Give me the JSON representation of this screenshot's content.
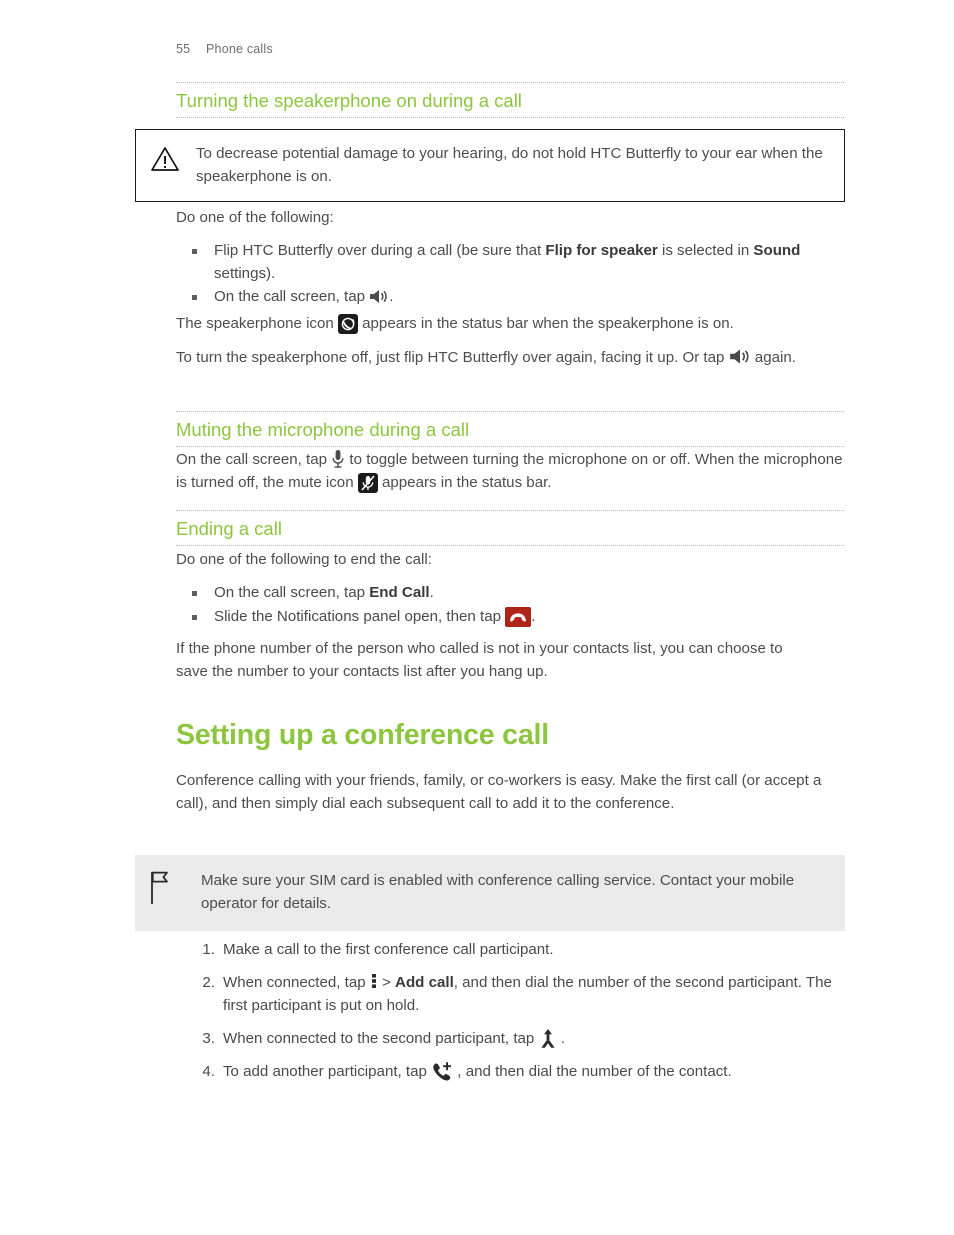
{
  "header": {
    "page_number": "55",
    "chapter": "Phone calls"
  },
  "colors": {
    "accent_green": "#8CC63F",
    "body_text": "#4d4d4d",
    "note_bg": "#eaeaea",
    "end_call_red": "#b02418",
    "status_icon_bg": "#1b1b1b"
  },
  "sections": {
    "speakerphone": {
      "heading": "Turning the speakerphone on during a call",
      "warning": "To decrease potential damage to your hearing, do not hold HTC Butterfly to your ear when the speakerphone is on.",
      "warning_icon": "warning-triangle-icon",
      "intro": "Do one of the following:",
      "bullets": [
        {
          "part1": "Flip HTC Butterfly over during a call (be sure that ",
          "bold1": "Flip for speaker",
          "part2": " is selected in ",
          "bold2": "Sound",
          "part3": " settings)."
        },
        {
          "part1": "On the call screen, tap ",
          "icon": "speaker-icon",
          "part3": "."
        }
      ],
      "para_status": {
        "part1": "The speakerphone icon ",
        "icon": "speakerphone-status-icon",
        "part2": " appears in the status bar when the speakerphone is on."
      },
      "para_off": {
        "part1": "To turn the speakerphone off, just flip HTC Butterfly over again, facing it up. Or tap ",
        "icon": "speaker-icon",
        "part2": " again."
      }
    },
    "muting": {
      "heading": "Muting the microphone during a call",
      "para": {
        "part1": "On the call screen, tap ",
        "icon1": "microphone-icon",
        "part2": " to toggle between turning the microphone on or off. When the microphone is turned off, the mute icon ",
        "icon2": "mute-status-icon",
        "part3": " appears in the status bar."
      }
    },
    "ending": {
      "heading": "Ending a call",
      "intro": "Do one of the following to end the call:",
      "bullets": [
        {
          "part1": "On the call screen, tap ",
          "bold1": "End Call",
          "part3": "."
        },
        {
          "part1": "Slide the Notifications panel open, then tap ",
          "icon": "end-call-icon",
          "part3": "."
        }
      ],
      "para_after": "If the phone number of the person who called is not in your contacts list, you can choose to save the number to your contacts list after you hang up."
    },
    "conference": {
      "heading": "Setting up a conference call",
      "intro": "Conference calling with your friends, family, or co-workers is easy. Make the first call (or accept a call), and then simply dial each subsequent call to add it to the conference.",
      "note": "Make sure your SIM card is enabled with conference calling service. Contact your mobile operator for details.",
      "note_icon": "flag-icon",
      "steps": [
        {
          "part1": "Make a call to the first conference call participant."
        },
        {
          "part1": "When connected, tap ",
          "icon": "more-vertical-icon",
          "part2": " > ",
          "bold1": "Add call",
          "part3": ", and then dial the number of the second participant. The first participant is put on hold."
        },
        {
          "part1": "When connected to the second participant, tap ",
          "icon": "merge-call-icon",
          "part3": " ."
        },
        {
          "part1": "To add another participant, tap ",
          "icon": "add-call-icon",
          "part3": " , and then dial the number of the contact."
        }
      ]
    }
  }
}
